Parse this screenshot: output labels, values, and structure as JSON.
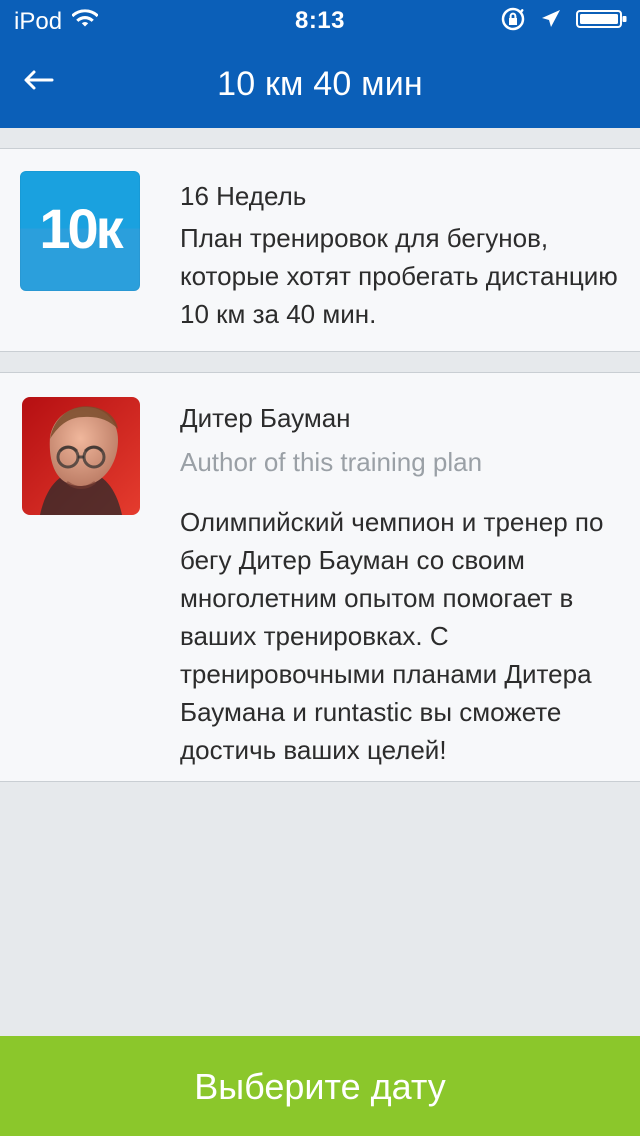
{
  "status_bar": {
    "carrier": "iPod",
    "time": "8:13",
    "icons": {
      "wifi": "wifi-icon",
      "rotation_lock": "rotation-lock-icon",
      "location": "location-arrow-icon",
      "battery": "battery-icon"
    }
  },
  "nav": {
    "title": "10 км 40 мин",
    "back_icon": "back-arrow-icon"
  },
  "plan": {
    "badge_text": "10к",
    "weeks": "16 Недель",
    "description": "План тренировок для бегунов, которые хотят пробегать дистанцию 10 км за 40 мин."
  },
  "author": {
    "name": "Дитер Бауман",
    "role": "Author of this training plan",
    "bio": "Олимпийский чемпион и тренер по бегу Дитер Бауман со своим многолетним опытом помогает в ваших тренировках. С тренировочными планами Дитера Баумана и runtastic вы сможете достичь ваших целей!"
  },
  "cta": {
    "label": "Выберите дату"
  },
  "colors": {
    "primary_blue": "#0b5fb8",
    "page_bg": "#e6e9ec",
    "card_bg": "#f7f8fa",
    "cta_green": "#8bc72b",
    "secondary_text": "#9aa0a6"
  }
}
